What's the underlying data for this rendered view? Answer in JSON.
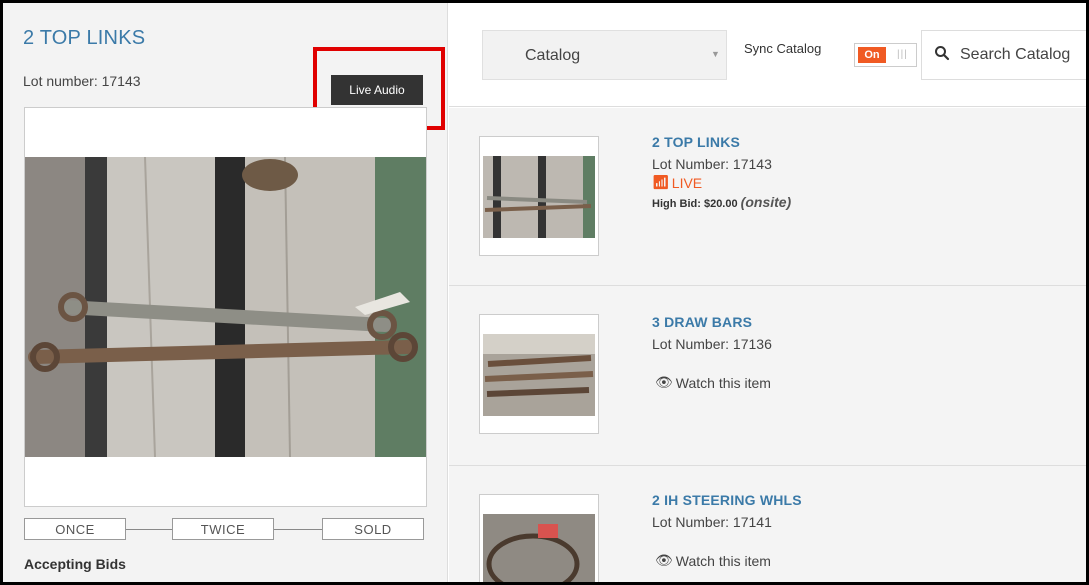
{
  "lot": {
    "title": "2 TOP LINKS",
    "lot_number_text": "Lot number: 17143",
    "live_audio_label": "Live Audio",
    "status": "Accepting Bids",
    "steps": [
      "ONCE",
      "TWICE",
      "SOLD"
    ]
  },
  "toolbar": {
    "catalog_label": "Catalog",
    "sync_label": "Sync Catalog",
    "toggle_on": "On",
    "search_placeholder": "Search Catalog"
  },
  "items": [
    {
      "title": "2 TOP LINKS",
      "lot_text": "Lot Number: 17143",
      "live_label": "LIVE",
      "high_bid_label": "High Bid:",
      "high_bid_value": "$20.00",
      "high_bid_note": "(onsite)"
    },
    {
      "title": "3 DRAW BARS",
      "lot_text": "Lot Number: 17136",
      "watch_label": "Watch this item"
    },
    {
      "title": "2 IH STEERING WHLS",
      "lot_text": "Lot Number: 17141",
      "watch_label": "Watch this item"
    }
  ],
  "colors": {
    "accent_blue": "#3b7aa8",
    "live_orange": "#f05a23",
    "highlight_red": "#e00000"
  }
}
